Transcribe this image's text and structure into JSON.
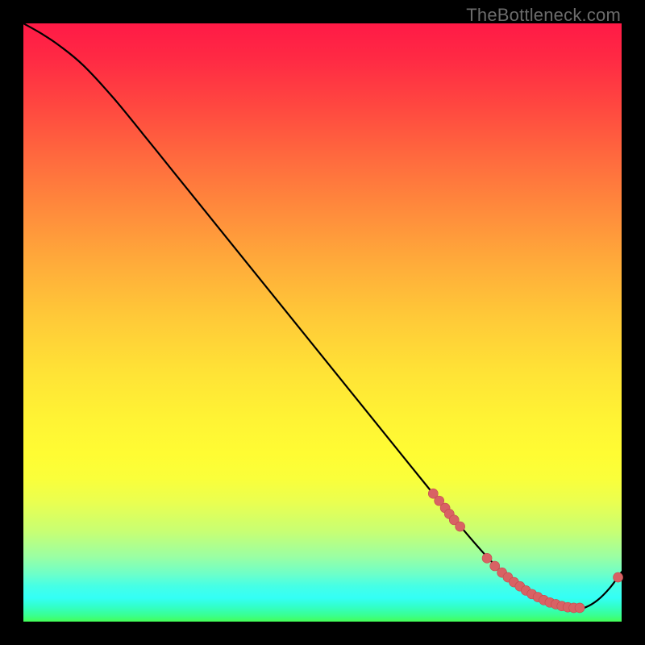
{
  "watermark": "TheBottleneck.com",
  "colors": {
    "curve": "#000000",
    "point_fill": "#d86264",
    "point_stroke": "#c44a4d"
  },
  "chart_data": {
    "type": "line",
    "title": "",
    "xlabel": "",
    "ylabel": "",
    "xlim": [
      0,
      100
    ],
    "ylim": [
      0,
      100
    ],
    "grid": false,
    "legend": false,
    "series": [
      {
        "name": "bottleneck_curve",
        "x": [
          0,
          3,
          6,
          10,
          15,
          20,
          25,
          30,
          35,
          40,
          45,
          50,
          55,
          60,
          65,
          68,
          70,
          73,
          76,
          78,
          80,
          82,
          84,
          86,
          88,
          90,
          92,
          94,
          96,
          98,
          100
        ],
        "y": [
          100,
          98.3,
          96.3,
          93,
          87.6,
          81.5,
          75.3,
          69.1,
          62.9,
          56.7,
          50.5,
          44.3,
          38.1,
          31.9,
          25.7,
          22,
          19.6,
          16,
          12.5,
          10.3,
          8.4,
          6.7,
          5.2,
          4,
          3,
          2.3,
          2,
          2.4,
          3.6,
          5.6,
          8.3
        ]
      }
    ],
    "scatter_points": {
      "name": "highlighted_points",
      "x": [
        68.5,
        69.5,
        70.5,
        71.2,
        72.0,
        73.0,
        77.5,
        78.8,
        80.0,
        81.0,
        82.0,
        83.0,
        84.0,
        85.0,
        86.0,
        87.0,
        88.0,
        89.0,
        90.0,
        91.0,
        92.0,
        93.0,
        99.4
      ],
      "y": [
        21.4,
        20.2,
        19.0,
        18.0,
        17.0,
        15.9,
        10.6,
        9.3,
        8.2,
        7.4,
        6.6,
        5.9,
        5.2,
        4.6,
        4.1,
        3.6,
        3.2,
        2.9,
        2.6,
        2.4,
        2.3,
        2.3,
        7.4
      ]
    }
  }
}
